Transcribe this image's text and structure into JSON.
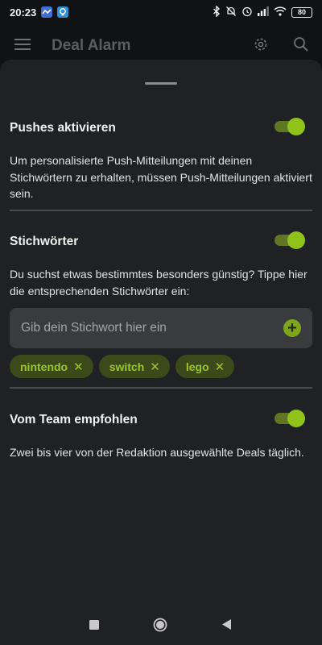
{
  "status_bar": {
    "time": "20:23",
    "battery": "80",
    "colors": {
      "app_badge_1": "#3f6fd6",
      "app_badge_2": "#2f8fd8"
    },
    "icons": [
      "app-notification-icon",
      "app-notification-icon",
      "bluetooth-icon",
      "mute-icon",
      "alarm-icon",
      "signal-icon",
      "wifi-icon",
      "battery-icon"
    ]
  },
  "app_bar": {
    "title": "Deal Alarm",
    "icons": [
      "menu-icon",
      "gear-icon",
      "search-icon"
    ]
  },
  "sections": {
    "pushes": {
      "title": "Pushes aktivieren",
      "enabled": true,
      "description": "Um personalisierte Push-Mitteilungen mit deinen Stichwörtern zu erhalten, müssen Push-Mitteilungen aktiviert sein."
    },
    "keywords": {
      "title": "Stichwörter",
      "enabled": true,
      "description": "Du suchst etwas bestimmtes besonders günstig? Tippe hier die entsprechenden Stichwörter ein:",
      "input_placeholder": "Gib dein Stichwort hier ein",
      "input_value": "",
      "chips": [
        "nintendo",
        "switch",
        "lego"
      ],
      "chip_remove_glyph": "✕",
      "add_glyph": "+"
    },
    "team": {
      "title": "Vom Team empfohlen",
      "enabled": true,
      "description": "Zwei bis vier von der Redaktion ausgewählte Deals täglich."
    }
  },
  "colors": {
    "accent": "#8fc31a",
    "accent_track": "#5f7723",
    "chip_bg": "#3a4a1a",
    "chip_text": "#9bc72b",
    "sheet_bg": "#202124",
    "background": "#0e0f11"
  },
  "nav_bar": {
    "icons": [
      "recent-apps-icon",
      "home-icon",
      "back-icon"
    ]
  }
}
